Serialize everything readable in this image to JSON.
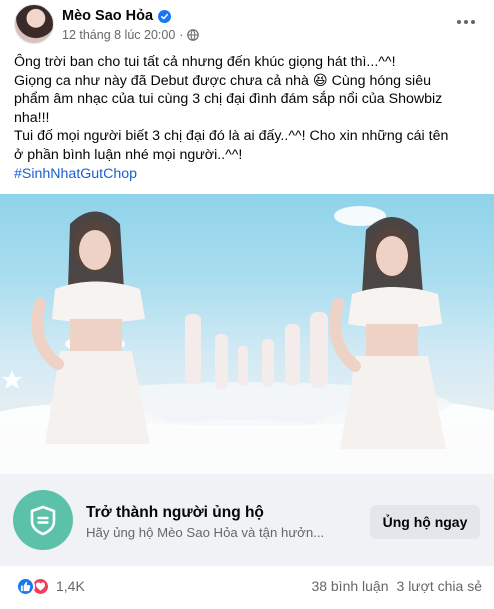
{
  "post": {
    "author": "Mèo Sao Hỏa",
    "timestamp": "12 tháng 8 lúc 20:00",
    "separator": "·",
    "verified_icon": "verified-badge-icon",
    "privacy_icon": "globe-icon",
    "more_icon": "more-horizontal-icon",
    "text_lines": [
      "Ông trời ban cho tui tất cả nhưng đến khúc giọng hát thì...^^!",
      "Giọng ca như này đã Debut được chưa cả nhà 😆 Cùng hóng siêu",
      "phẩm âm nhạc của tui cùng 3 chị đại đình đám sắp nổi của Showbiz",
      "nha!!!",
      "Tui đố mọi người biết 3 chị đại đó là ai đấy..^^! Cho xin những cái tên",
      "ở phần bình luận nhé mọi người..^^!"
    ],
    "hashtag": "#SinhNhatGutChop",
    "media_alt_icon": "video-thumbnail"
  },
  "supporter": {
    "badge_icon": "supporter-badge-icon",
    "title": "Trở thành người ủng hộ",
    "subtitle": "Hãy ủng hộ Mèo Sao Hỏa và tận hưởn...",
    "button_label": "Ủng hộ ngay"
  },
  "stats": {
    "reactions_icons": [
      "like-icon",
      "love-icon"
    ],
    "reaction_count": "1,4K",
    "comments": "38 bình luận",
    "shares": "3 lượt chia sẻ"
  },
  "colors": {
    "link_blue": "#1a5fd1",
    "facebook_blue": "#1877f2",
    "love_red": "#f33e58",
    "supporter_green": "#5bc2a9",
    "card_bg": "#f0f2f5",
    "secondary_text": "#65676b"
  }
}
